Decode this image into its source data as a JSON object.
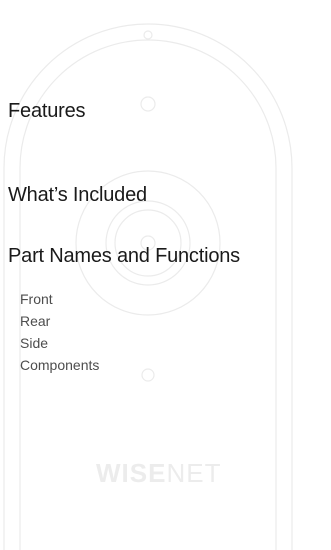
{
  "toc": {
    "features": "Features",
    "whats_included": "What’s Included",
    "part_names": "Part Names and Functions",
    "subsections": [
      "Front",
      "Rear",
      "Side",
      "Components"
    ]
  },
  "watermark": {
    "brand_bold": "WISE",
    "brand_thin": "NET"
  }
}
